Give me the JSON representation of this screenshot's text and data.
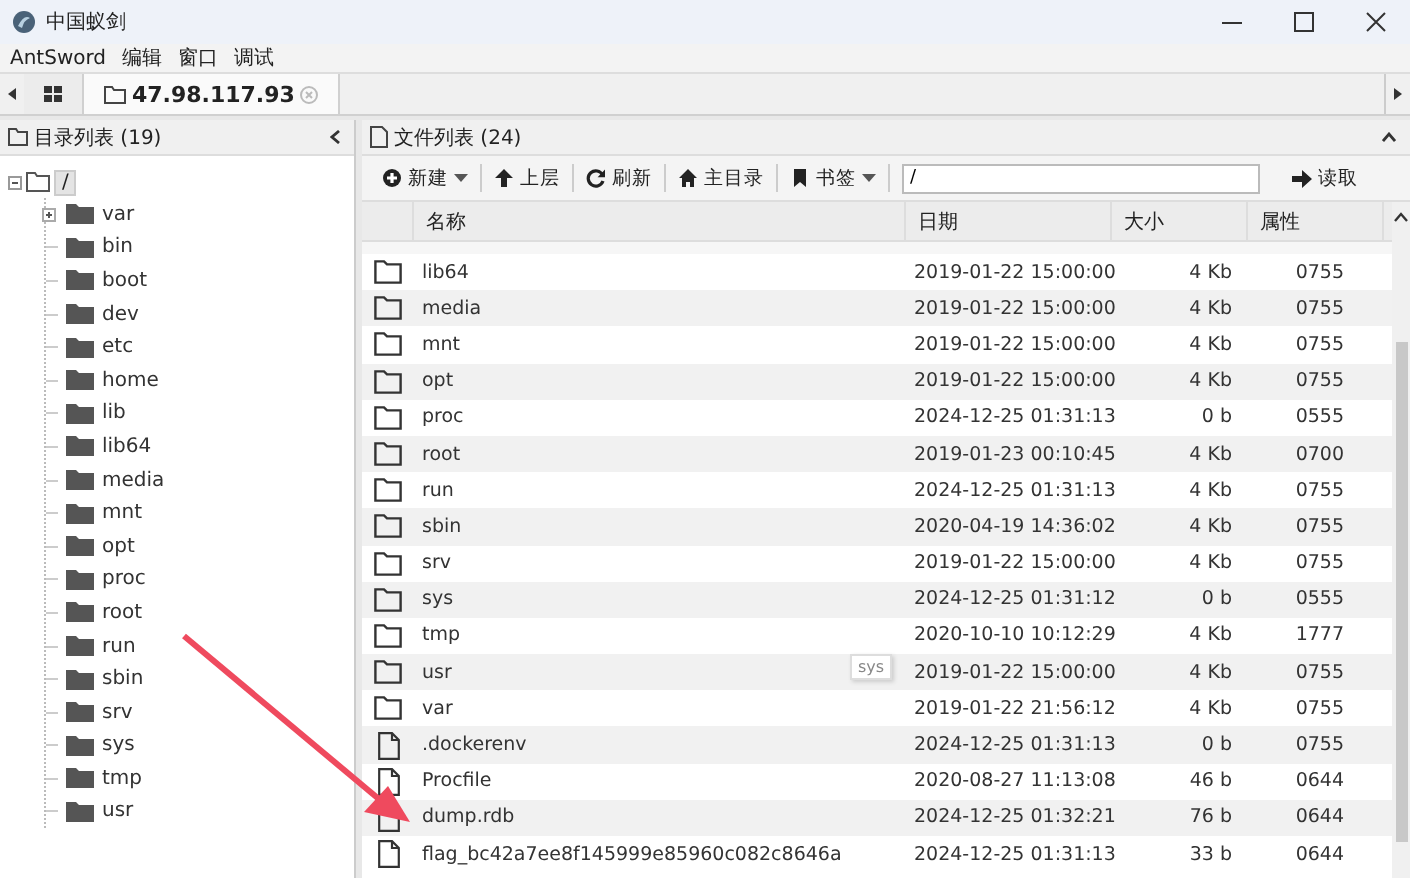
{
  "window": {
    "title": "中国蚁剑"
  },
  "menu": [
    "AntSword",
    "编辑",
    "窗口",
    "调试"
  ],
  "tabs": [
    {
      "kind": "grid",
      "selected": false
    },
    {
      "kind": "host",
      "label": "47.98.117.93",
      "selected": true
    }
  ],
  "left_panel": {
    "title": "目录列表 (19)",
    "tree": {
      "label": "/",
      "expanded": true,
      "children": [
        {
          "label": "var",
          "expandable": true
        },
        {
          "label": "bin",
          "expandable": false
        },
        {
          "label": "boot",
          "expandable": false
        },
        {
          "label": "dev",
          "expandable": false
        },
        {
          "label": "etc",
          "expandable": false
        },
        {
          "label": "home",
          "expandable": false
        },
        {
          "label": "lib",
          "expandable": false
        },
        {
          "label": "lib64",
          "expandable": false
        },
        {
          "label": "media",
          "expandable": false
        },
        {
          "label": "mnt",
          "expandable": false
        },
        {
          "label": "opt",
          "expandable": false
        },
        {
          "label": "proc",
          "expandable": false
        },
        {
          "label": "root",
          "expandable": false
        },
        {
          "label": "run",
          "expandable": false
        },
        {
          "label": "sbin",
          "expandable": false
        },
        {
          "label": "srv",
          "expandable": false
        },
        {
          "label": "sys",
          "expandable": false
        },
        {
          "label": "tmp",
          "expandable": false
        },
        {
          "label": "usr",
          "expandable": false
        }
      ]
    }
  },
  "right_panel": {
    "title": "文件列表 (24)",
    "toolbar": [
      {
        "kind": "new",
        "label": "新建",
        "dropdown": true
      },
      {
        "kind": "up",
        "label": "上层",
        "dropdown": false
      },
      {
        "kind": "refresh",
        "label": "刷新",
        "dropdown": false
      },
      {
        "kind": "home",
        "label": "主目录",
        "dropdown": false
      },
      {
        "kind": "bookmark",
        "label": "书签",
        "dropdown": true
      }
    ],
    "path": "/",
    "go": "读取",
    "columns": [
      "名称",
      "日期",
      "大小",
      "属性"
    ],
    "rows": [
      {
        "kind": "folder",
        "name": "lib64",
        "date": "2019-01-22 15:00:00",
        "size": "4 Kb",
        "perm": "0755"
      },
      {
        "kind": "folder",
        "name": "media",
        "date": "2019-01-22 15:00:00",
        "size": "4 Kb",
        "perm": "0755"
      },
      {
        "kind": "folder",
        "name": "mnt",
        "date": "2019-01-22 15:00:00",
        "size": "4 Kb",
        "perm": "0755"
      },
      {
        "kind": "folder",
        "name": "opt",
        "date": "2019-01-22 15:00:00",
        "size": "4 Kb",
        "perm": "0755"
      },
      {
        "kind": "folder",
        "name": "proc",
        "date": "2024-12-25 01:31:13",
        "size": "0 b",
        "perm": "0555"
      },
      {
        "kind": "folder",
        "name": "root",
        "date": "2019-01-23 00:10:45",
        "size": "4 Kb",
        "perm": "0700"
      },
      {
        "kind": "folder",
        "name": "run",
        "date": "2024-12-25 01:31:13",
        "size": "4 Kb",
        "perm": "0755"
      },
      {
        "kind": "folder",
        "name": "sbin",
        "date": "2020-04-19 14:36:02",
        "size": "4 Kb",
        "perm": "0755"
      },
      {
        "kind": "folder",
        "name": "srv",
        "date": "2019-01-22 15:00:00",
        "size": "4 Kb",
        "perm": "0755"
      },
      {
        "kind": "folder",
        "name": "sys",
        "date": "2024-12-25 01:31:12",
        "size": "0 b",
        "perm": "0555"
      },
      {
        "kind": "folder",
        "name": "tmp",
        "date": "2020-10-10 10:12:29",
        "size": "4 Kb",
        "perm": "1777"
      },
      {
        "kind": "folder",
        "name": "usr",
        "date": "2019-01-22 15:00:00",
        "size": "4 Kb",
        "perm": "0755"
      },
      {
        "kind": "folder",
        "name": "var",
        "date": "2019-01-22 21:56:12",
        "size": "4 Kb",
        "perm": "0755"
      },
      {
        "kind": "file",
        "name": ".dockerenv",
        "date": "2024-12-25 01:31:13",
        "size": "0 b",
        "perm": "0755"
      },
      {
        "kind": "file",
        "name": "Procfile",
        "date": "2020-08-27 11:13:08",
        "size": "46 b",
        "perm": "0644"
      },
      {
        "kind": "file",
        "name": "dump.rdb",
        "date": "2024-12-25 01:32:21",
        "size": "76 b",
        "perm": "0644"
      },
      {
        "kind": "file",
        "name": "flag_bc42a7ee8f145999e85960c082c8646a",
        "date": "2024-12-25 01:31:13",
        "size": "33 b",
        "perm": "0644"
      }
    ],
    "tooltip": "sys"
  }
}
